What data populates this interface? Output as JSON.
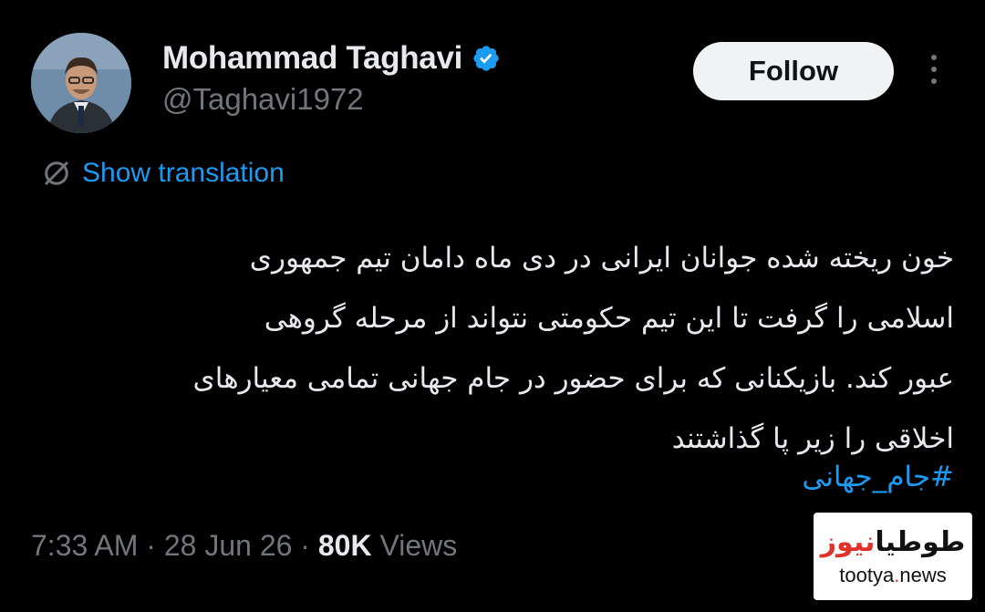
{
  "user": {
    "display_name": "Mohammad Taghavi",
    "handle": "@Taghavi1972",
    "verified": true,
    "verified_color": "#1d9bf0"
  },
  "actions": {
    "follow_label": "Follow"
  },
  "translation": {
    "label": "Show translation",
    "icon": "globe-off-icon"
  },
  "tweet": {
    "lines": [
      "خون  ریخته شده جوانان ایرانی در دی ماه دامان تیم جمهوری",
      "اسلامی  را گرفت تا این تیم حکومتی نتواند از مرحله گروهی",
      "عبور کند. بازیکنانی که برای حضور در جام جهانی تمامی معیارهای",
      "اخلاقی را زیر  پا گذاشتند"
    ],
    "hashtag": "#جام_جهانی"
  },
  "meta": {
    "time": "7:33 AM",
    "separator1": "·",
    "date": "28 Jun 26",
    "separator2": "·",
    "views_count": "80K",
    "views_label": "Views"
  },
  "watermark": {
    "logo_part1": "طوطیا",
    "logo_part2": "نیوز",
    "url_part1": "tootya",
    "url_dot": ".",
    "url_part2": "news"
  },
  "colors": {
    "background": "#000000",
    "accent": "#1d9bf0",
    "text": "#e7e9ea",
    "secondary_text": "#71767b"
  }
}
